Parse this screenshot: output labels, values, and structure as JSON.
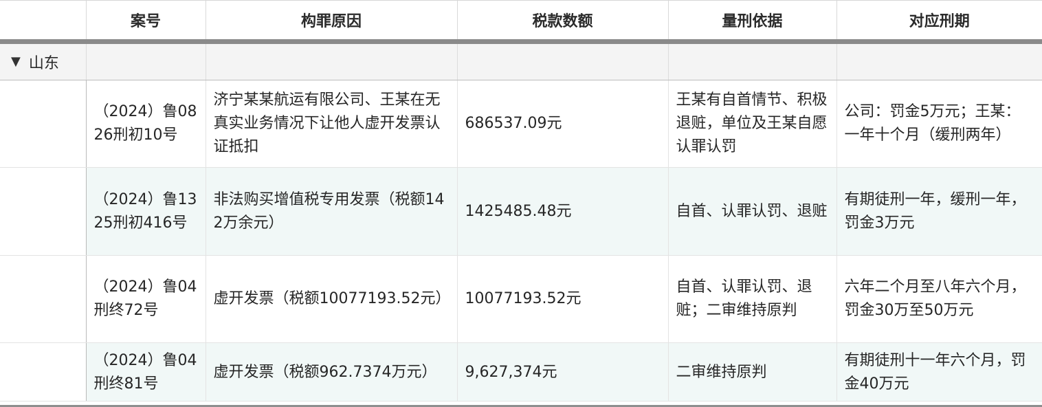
{
  "table": {
    "headers": [
      "",
      "案号",
      "构罪原因",
      "税款数额",
      "量刑依据",
      "对应刑期"
    ],
    "group": {
      "expanded_glyph": "▼",
      "label": "山东"
    },
    "rows": [
      {
        "case_no": "（2024）鲁0826刑初10号",
        "reason": "济宁某某航运有限公司、王某在无真实业务情况下让他人虚开发票认证抵扣",
        "amount": "686537.09元",
        "basis": "王某有自首情节、积极退赃，单位及王某自愿认罪认罚",
        "sentence": "公司：罚金5万元；王某：一年十个月（缓刑两年）"
      },
      {
        "case_no": "（2024）鲁1325刑初416号",
        "reason": "非法购买增值税专用发票（税额142万余元）",
        "amount": "1425485.48元",
        "basis": "自首、认罪认罚、退赃",
        "sentence": "有期徒刑一年，缓刑一年，罚金3万元"
      },
      {
        "case_no": "（2024）鲁04刑终72号",
        "reason": "虚开发票（税额10077193.52元）",
        "amount": "10077193.52元",
        "basis": "自首、认罪认罚、退赃；二审维持原判",
        "sentence": "六年二个月至八年六个月，罚金30万至50万元"
      },
      {
        "case_no": "（2024）鲁04刑终81号",
        "reason": "虚开发票（税额962.7374万元）",
        "amount": "9,627,374元",
        "basis": "二审维持原判",
        "sentence": "有期徒刑十一年六个月，罚金40万元"
      }
    ]
  }
}
